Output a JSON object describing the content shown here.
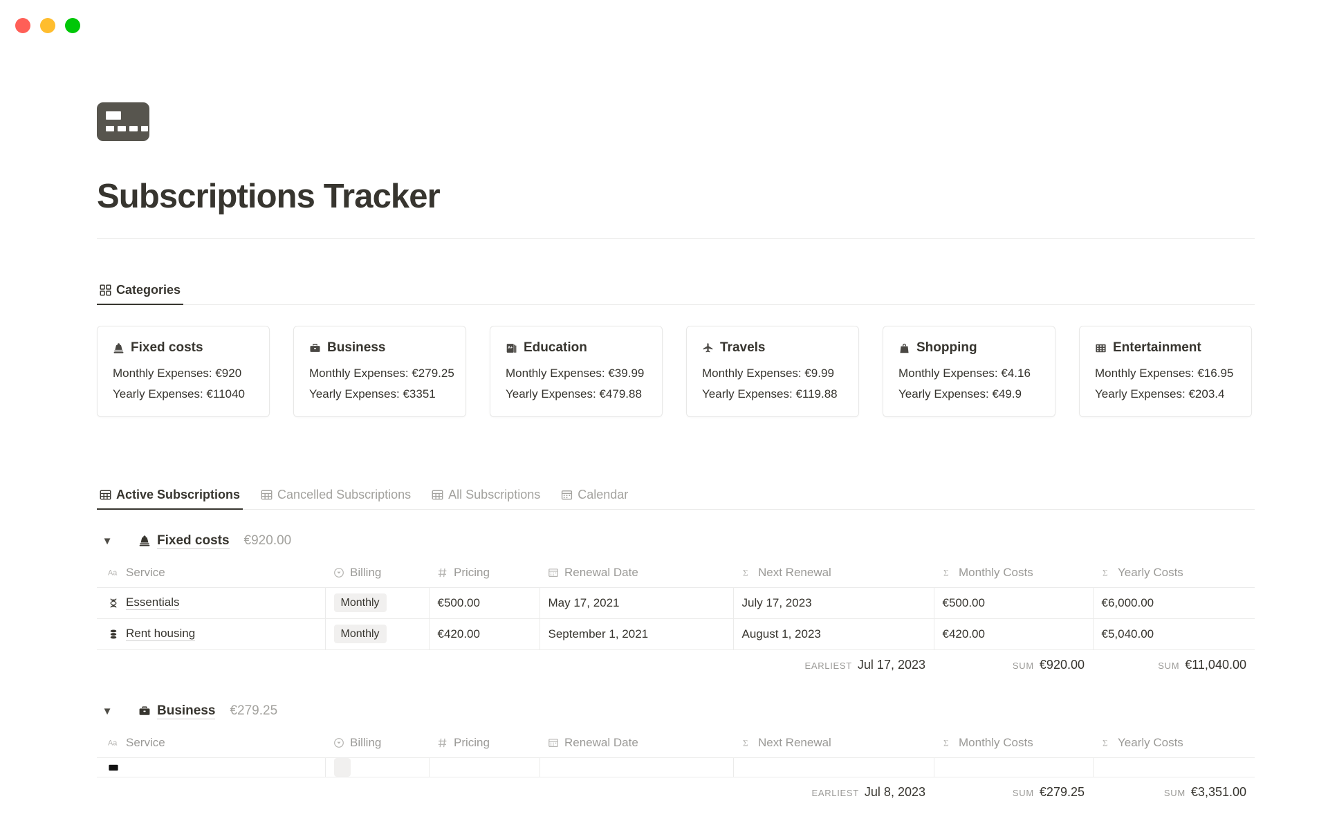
{
  "window": {
    "traffic_lights": [
      {
        "name": "close",
        "color": "#FF5F57"
      },
      {
        "name": "minimize",
        "color": "#FFBD2E"
      },
      {
        "name": "maximize",
        "color": "#00C707"
      }
    ]
  },
  "page": {
    "icon": "credit-card-icon",
    "title": "Subscriptions Tracker"
  },
  "categories_view": {
    "tabs": [
      {
        "label": "Categories",
        "icon": "gallery-grid-icon",
        "active": true
      }
    ],
    "cards": [
      {
        "name": "Fixed costs",
        "icon": "weight-scale-icon",
        "monthly_label": "Monthly Expenses: €920",
        "yearly_label": "Yearly Expenses: €11040"
      },
      {
        "name": "Business",
        "icon": "briefcase-icon",
        "monthly_label": "Monthly Expenses: €279.25",
        "yearly_label": "Yearly Expenses: €3351"
      },
      {
        "name": "Education",
        "icon": "book-a-plus-icon",
        "monthly_label": "Monthly Expenses: €39.99",
        "yearly_label": "Yearly Expenses: €479.88"
      },
      {
        "name": "Travels",
        "icon": "airplane-icon",
        "monthly_label": "Monthly Expenses: €9.99",
        "yearly_label": "Yearly Expenses: €119.88"
      },
      {
        "name": "Shopping",
        "icon": "shopping-bag-icon",
        "monthly_label": "Monthly Expenses: €4.16",
        "yearly_label": "Yearly Expenses: €49.9"
      },
      {
        "name": "Entertainment",
        "icon": "film-strip-icon",
        "monthly_label": "Monthly Expenses: €16.95",
        "yearly_label": "Yearly Expenses: €203.4"
      }
    ]
  },
  "subscriptions_view": {
    "tabs": [
      {
        "label": "Active Subscriptions",
        "icon": "table-icon",
        "active": true
      },
      {
        "label": "Cancelled Subscriptions",
        "icon": "table-icon",
        "active": false
      },
      {
        "label": "All Subscriptions",
        "icon": "table-icon",
        "active": false
      },
      {
        "label": "Calendar",
        "icon": "calendar-icon",
        "active": false
      }
    ],
    "columns": [
      {
        "label": "Service",
        "icon": "text-aa-icon"
      },
      {
        "label": "Billing",
        "icon": "select-circle-icon"
      },
      {
        "label": "Pricing",
        "icon": "number-hash-icon"
      },
      {
        "label": "Renewal Date",
        "icon": "calendar-icon"
      },
      {
        "label": "Next Renewal",
        "icon": "formula-sigma-icon"
      },
      {
        "label": "Monthly Costs",
        "icon": "formula-sigma-icon"
      },
      {
        "label": "Yearly Costs",
        "icon": "formula-sigma-icon"
      }
    ],
    "groups": [
      {
        "name": "Fixed costs",
        "icon": "weight-scale-icon",
        "total": "€920.00",
        "expanded": true,
        "rows": [
          {
            "service": "Essentials",
            "service_icon": "dna-icon",
            "billing": "Monthly",
            "pricing": "€500.00",
            "renewal_date": "May 17, 2021",
            "next_renewal": "July 17, 2023",
            "monthly_costs": "€500.00",
            "yearly_costs": "€6,000.00"
          },
          {
            "service": "Rent housing",
            "service_icon": "coins-stack-icon",
            "billing": "Monthly",
            "pricing": "€420.00",
            "renewal_date": "September 1, 2021",
            "next_renewal": "August 1, 2023",
            "monthly_costs": "€420.00",
            "yearly_costs": "€5,040.00"
          }
        ],
        "summary": {
          "next_renewal_label": "EARLIEST",
          "next_renewal_value": "Jul 17, 2023",
          "monthly_label": "SUM",
          "monthly_value": "€920.00",
          "yearly_label": "SUM",
          "yearly_value": "€11,040.00"
        }
      },
      {
        "name": "Business",
        "icon": "briefcase-icon",
        "total": "€279.25",
        "expanded": true,
        "rows": [],
        "summary": {
          "next_renewal_label": "EARLIEST",
          "next_renewal_value": "Jul 8, 2023",
          "monthly_label": "SUM",
          "monthly_value": "€279.25",
          "yearly_label": "SUM",
          "yearly_value": "€3,351.00"
        }
      }
    ]
  }
}
